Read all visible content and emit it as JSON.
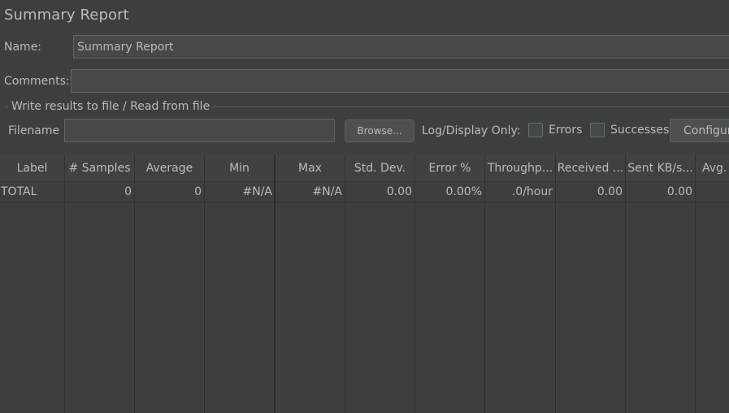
{
  "panel": {
    "title": "Summary Report",
    "name_label": "Name:",
    "name_value": "Summary Report",
    "comments_label": "Comments:",
    "comments_value": ""
  },
  "file_group": {
    "title": "Write results to file / Read from file",
    "filename_label": "Filename",
    "filename_value": "",
    "browse_label": "Browse...",
    "log_display_label": "Log/Display Only:",
    "errors_label": "Errors",
    "errors_checked": false,
    "successes_label": "Successes",
    "successes_checked": false,
    "configure_label": "Configure"
  },
  "table": {
    "columns": [
      "Label",
      "# Samples",
      "Average",
      "Min",
      "Max",
      "Std. Dev.",
      "Error %",
      "Throughp...",
      "Received ...",
      "Sent KB/s...",
      "Avg. Bytes"
    ],
    "rows": [
      [
        "TOTAL",
        "0",
        "0",
        "#N/A",
        "#N/A",
        "0.00",
        "0.00%",
        ".0/hour",
        "0.00",
        "0.00",
        ""
      ]
    ]
  }
}
